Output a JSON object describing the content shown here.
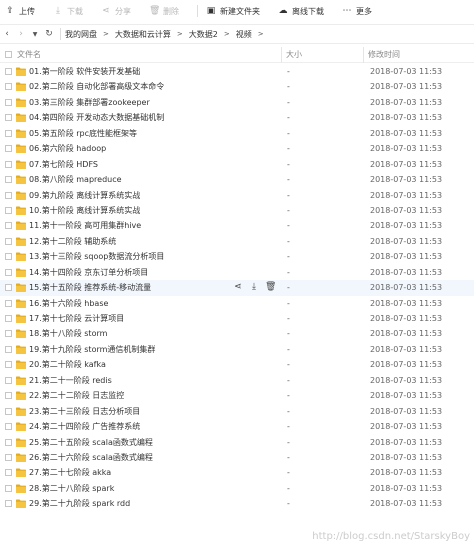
{
  "toolbar": {
    "upload": "上传",
    "download": "下载",
    "share": "分享",
    "delete": "删除",
    "new_folder": "新建文件夹",
    "offline_download": "离线下载",
    "more": "更多"
  },
  "nav": {
    "breadcrumb": [
      "我的网盘",
      "大数据和云计算",
      "大数据2",
      "视频"
    ]
  },
  "columns": {
    "name": "文件名",
    "size": "大小",
    "modified": "修改时间"
  },
  "files": [
    {
      "name": "01.第一阶段 软件安装开发基础",
      "size": "-",
      "modified": "2018-07-03 11:53"
    },
    {
      "name": "02.第二阶段 自动化部署高级文本命令",
      "size": "-",
      "modified": "2018-07-03 11:53"
    },
    {
      "name": "03.第三阶段 集群部署zookeeper",
      "size": "-",
      "modified": "2018-07-03 11:53"
    },
    {
      "name": "04.第四阶段 开发动态大数据基础机制",
      "size": "-",
      "modified": "2018-07-03 11:53"
    },
    {
      "name": "05.第五阶段 rpc底性能框架等",
      "size": "-",
      "modified": "2018-07-03 11:53"
    },
    {
      "name": "06.第六阶段 hadoop",
      "size": "-",
      "modified": "2018-07-03 11:53"
    },
    {
      "name": "07.第七阶段 HDFS",
      "size": "-",
      "modified": "2018-07-03 11:53"
    },
    {
      "name": "08.第八阶段 mapreduce",
      "size": "-",
      "modified": "2018-07-03 11:53"
    },
    {
      "name": "09.第九阶段 离线计算系统实战",
      "size": "-",
      "modified": "2018-07-03 11:53"
    },
    {
      "name": "10.第十阶段 离线计算系统实战",
      "size": "-",
      "modified": "2018-07-03 11:53"
    },
    {
      "name": "11.第十一阶段 高可用集群hive",
      "size": "-",
      "modified": "2018-07-03 11:53"
    },
    {
      "name": "12.第十二阶段 辅助系统",
      "size": "-",
      "modified": "2018-07-03 11:53"
    },
    {
      "name": "13.第十三阶段 sqoop数据流分析项目",
      "size": "-",
      "modified": "2018-07-03 11:53"
    },
    {
      "name": "14.第十四阶段 京东订单分析项目",
      "size": "-",
      "modified": "2018-07-03 11:53"
    },
    {
      "name": "15.第十五阶段 推荐系统-移动流量",
      "size": "-",
      "modified": "2018-07-03 11:53"
    },
    {
      "name": "16.第十六阶段 hbase",
      "size": "-",
      "modified": "2018-07-03 11:53"
    },
    {
      "name": "17.第十七阶段 云计算项目",
      "size": "-",
      "modified": "2018-07-03 11:53"
    },
    {
      "name": "18.第十八阶段 storm",
      "size": "-",
      "modified": "2018-07-03 11:53"
    },
    {
      "name": "19.第十九阶段 storm通信机制集群",
      "size": "-",
      "modified": "2018-07-03 11:53"
    },
    {
      "name": "20.第二十阶段 kafka",
      "size": "-",
      "modified": "2018-07-03 11:53"
    },
    {
      "name": "21.第二十一阶段 redis",
      "size": "-",
      "modified": "2018-07-03 11:53"
    },
    {
      "name": "22.第二十二阶段 日志监控",
      "size": "-",
      "modified": "2018-07-03 11:53"
    },
    {
      "name": "23.第二十三阶段 日志分析项目",
      "size": "-",
      "modified": "2018-07-03 11:53"
    },
    {
      "name": "24.第二十四阶段 广告推荐系统",
      "size": "-",
      "modified": "2018-07-03 11:53"
    },
    {
      "name": "25.第二十五阶段 scala函数式编程",
      "size": "-",
      "modified": "2018-07-03 11:53"
    },
    {
      "name": "26.第二十六阶段 scala函数式编程",
      "size": "-",
      "modified": "2018-07-03 11:53"
    },
    {
      "name": "27.第二十七阶段 akka",
      "size": "-",
      "modified": "2018-07-03 11:53"
    },
    {
      "name": "28.第二十八阶段 spark",
      "size": "-",
      "modified": "2018-07-03 11:53"
    },
    {
      "name": "29.第二十九阶段 spark rdd",
      "size": "-",
      "modified": "2018-07-03 11:53"
    }
  ],
  "hovered_row": 14,
  "watermark": "http://blog.csdn.net/StarskyBoy",
  "colors": {
    "folder": "#f5c542",
    "folder_dark": "#e3ac1f",
    "hover_row": "#f2f7fe"
  }
}
